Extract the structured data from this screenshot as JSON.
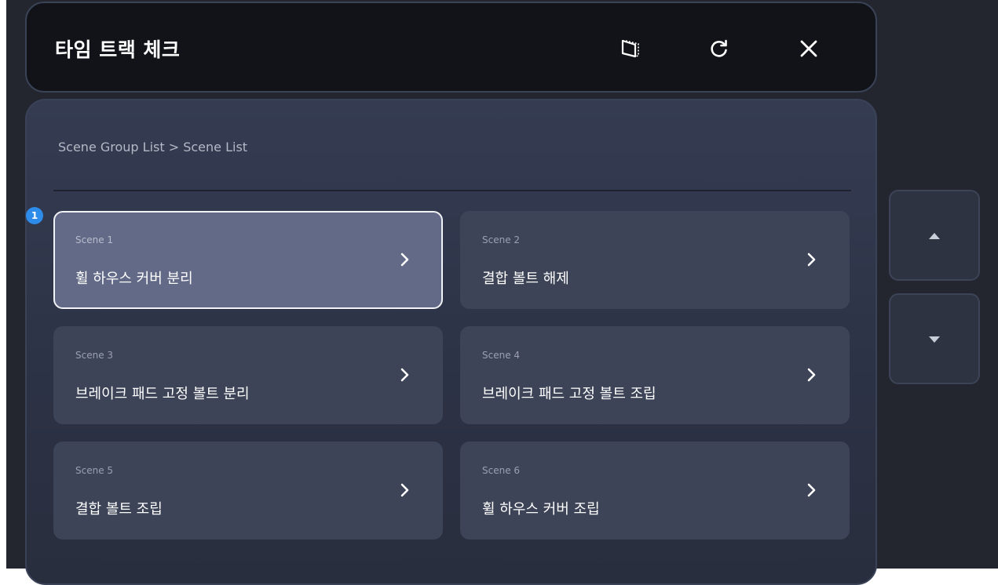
{
  "header": {
    "title": "타임 트랙 체크",
    "icons": [
      "frame-icon",
      "refresh-icon",
      "close-icon"
    ]
  },
  "breadcrumb": "Scene Group List > Scene List",
  "badge": "1",
  "scenes": [
    {
      "sub": "Scene 1",
      "title": "휠 하우스 커버 분리",
      "selected": true
    },
    {
      "sub": "Scene 2",
      "title": "결합 볼트 해제",
      "selected": false
    },
    {
      "sub": "Scene 3",
      "title": "브레이크 패드 고정 볼트 분리",
      "selected": false
    },
    {
      "sub": "Scene 4",
      "title": "브레이크 패드 고정 볼트 조립",
      "selected": false
    },
    {
      "sub": "Scene 5",
      "title": "결합 볼트 조립",
      "selected": false
    },
    {
      "sub": "Scene 6",
      "title": "휠 하우스 커버 조립",
      "selected": false
    }
  ],
  "side_buttons": [
    "scroll-up-icon",
    "scroll-down-icon"
  ],
  "colors": {
    "accent": "#2d8cea",
    "selected_card": "#626a87",
    "card": "#3d4458"
  }
}
